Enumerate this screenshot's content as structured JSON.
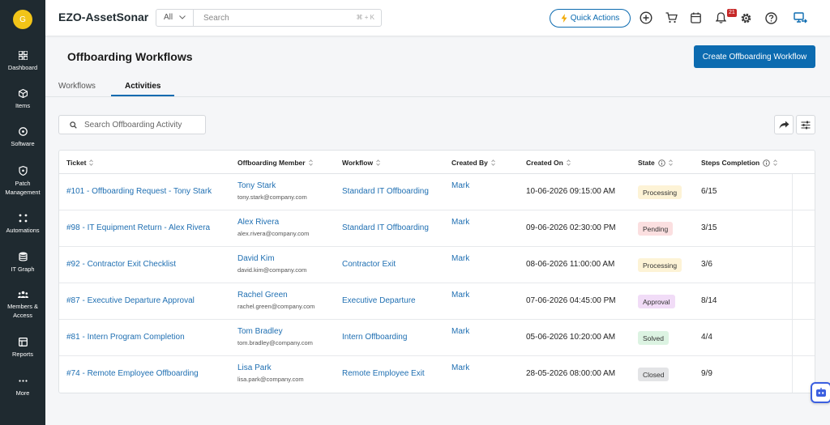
{
  "user": {
    "initial": "G"
  },
  "sidebar": {
    "items": [
      {
        "label": "Dashboard",
        "icon": "dashboard-icon"
      },
      {
        "label": "Items",
        "icon": "cube-icon"
      },
      {
        "label": "Software",
        "icon": "disc-icon"
      },
      {
        "label": "Patch Management",
        "icon": "shield-icon"
      },
      {
        "label": "Automations",
        "icon": "automation-icon"
      },
      {
        "label": "IT Graph",
        "icon": "database-icon"
      },
      {
        "label": "Members & Access",
        "icon": "members-icon"
      },
      {
        "label": "Reports",
        "icon": "reports-icon"
      },
      {
        "label": "More",
        "icon": "more-icon"
      }
    ]
  },
  "topbar": {
    "brand": "EZO-AssetSonar",
    "scope": "All",
    "search_placeholder": "Search",
    "shortcut": "⌘ + K",
    "quick_actions": "Quick Actions",
    "notification_count": "21"
  },
  "page": {
    "title": "Offboarding Workflows",
    "create_button": "Create Offboarding Workflow",
    "tabs": [
      {
        "label": "Workflows",
        "active": false
      },
      {
        "label": "Activities",
        "active": true
      }
    ],
    "activity_search_placeholder": "Search Offboarding Activity"
  },
  "table": {
    "headers": [
      "Ticket",
      "Offboarding Member",
      "Workflow",
      "Created By",
      "Created On",
      "State",
      "Steps Completion"
    ],
    "rows": [
      {
        "ticket": "#101 - Offboarding Request - Tony Stark",
        "member": "Tony Stark",
        "email": "tony.stark@company.com",
        "workflow": "Standard IT Offboarding",
        "created_by": "Mark",
        "created_on": "10-06-2026 09:15:00 AM",
        "state": "Processing",
        "state_color": "#fdf3d6",
        "steps": "6/15"
      },
      {
        "ticket": "#98 - IT Equipment Return - Alex Rivera",
        "member": "Alex Rivera",
        "email": "alex.rivera@company.com",
        "workflow": "Standard IT Offboarding",
        "created_by": "Mark",
        "created_on": "09-06-2026 02:30:00 PM",
        "state": "Pending",
        "state_color": "#fbdfe0",
        "steps": "3/15"
      },
      {
        "ticket": "#92 - Contractor Exit Checklist",
        "member": "David Kim",
        "email": "david.kim@company.com",
        "workflow": "Contractor Exit",
        "created_by": "Mark",
        "created_on": "08-06-2026 11:00:00 AM",
        "state": "Processing",
        "state_color": "#fdf3d6",
        "steps": "3/6"
      },
      {
        "ticket": "#87 - Executive Departure Approval",
        "member": "Rachel Green",
        "email": "rachel.green@company.com",
        "workflow": "Executive Departure",
        "created_by": "Mark",
        "created_on": "07-06-2026 04:45:00 PM",
        "state": "Approval",
        "state_color": "#f1dcf7",
        "steps": "8/14"
      },
      {
        "ticket": "#81 - Intern Program Completion",
        "member": "Tom Bradley",
        "email": "tom.bradley@company.com",
        "workflow": "Intern Offboarding",
        "created_by": "Mark",
        "created_on": "05-06-2026 10:20:00 AM",
        "state": "Solved",
        "state_color": "#dcf3e2",
        "steps": "4/4"
      },
      {
        "ticket": "#74 - Remote Employee Offboarding",
        "member": "Lisa Park",
        "email": "lisa.park@company.com",
        "workflow": "Remote Employee Exit",
        "created_by": "Mark",
        "created_on": "28-05-2026 08:00:00 AM",
        "state": "Closed",
        "state_color": "#e3e4e6",
        "steps": "9/9"
      }
    ]
  },
  "colors": {
    "accent": "#0c6bb0",
    "sidebar": "#1f2a30",
    "link": "#1f6fb2"
  }
}
